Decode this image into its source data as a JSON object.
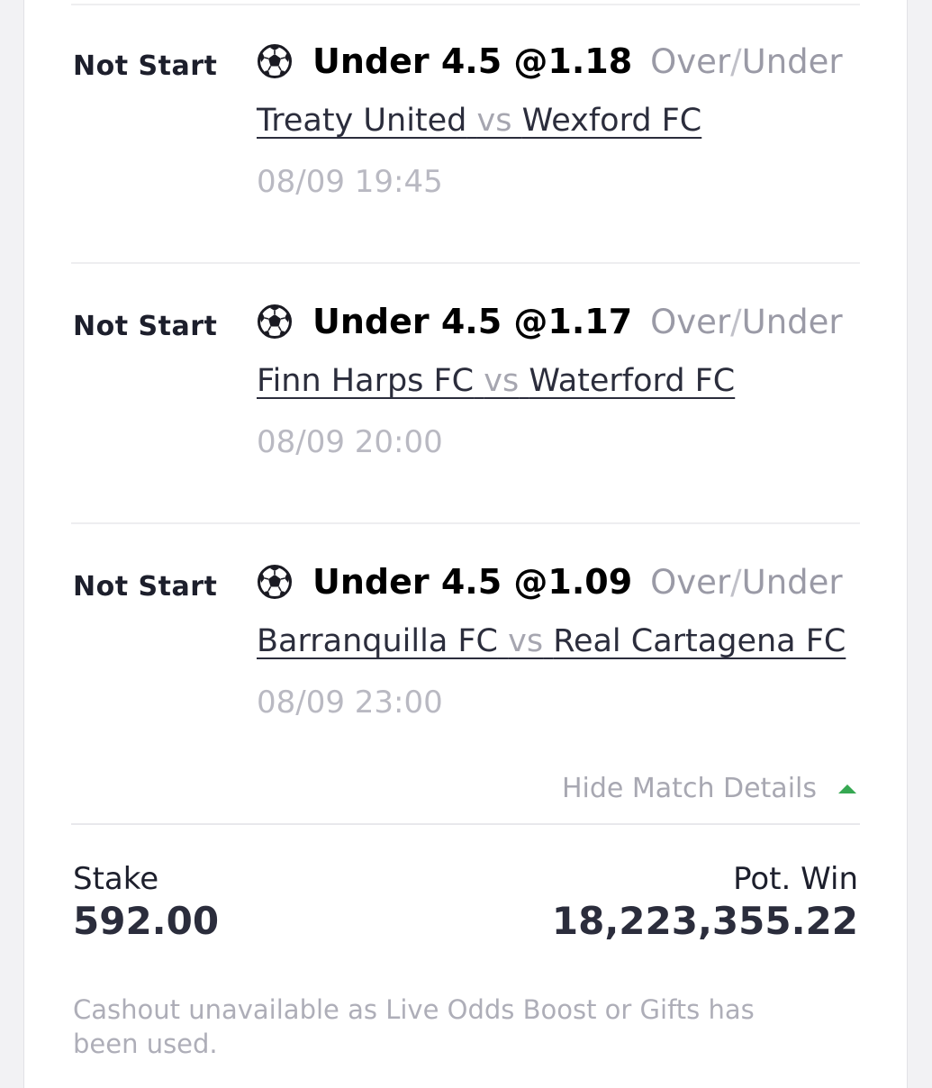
{
  "bets": [
    {
      "status": "Not Start",
      "pick": "Under 4.5 @1.18",
      "market": {
        "left": "Over",
        "sep": "/",
        "right": "Under"
      },
      "home": "Treaty United",
      "vs": "vs",
      "away": "Wexford FC",
      "time": "08/09 19:45"
    },
    {
      "status": "Not Start",
      "pick": "Under 4.5 @1.17",
      "market": {
        "left": "Over",
        "sep": "/",
        "right": "Under"
      },
      "home": "Finn Harps FC",
      "vs": "vs",
      "away": "Waterford FC",
      "time": "08/09 20:00"
    },
    {
      "status": "Not Start",
      "pick": "Under 4.5 @1.09",
      "market": {
        "left": "Over",
        "sep": "/",
        "right": "Under"
      },
      "home": "Barranquilla FC",
      "vs": "vs",
      "away": "Real Cartagena FC",
      "time": "08/09 23:00"
    }
  ],
  "toggle": {
    "label": "Hide Match Details",
    "caret_color": "#36a852"
  },
  "totals": {
    "stake_label": "Stake",
    "stake_value": "592.00",
    "win_label": "Pot. Win",
    "win_value": "18,223,355.22"
  },
  "note": "Cashout unavailable as Live Odds Boost or Gifts has been used.",
  "icons": {
    "sport": "soccer-ball-icon"
  }
}
